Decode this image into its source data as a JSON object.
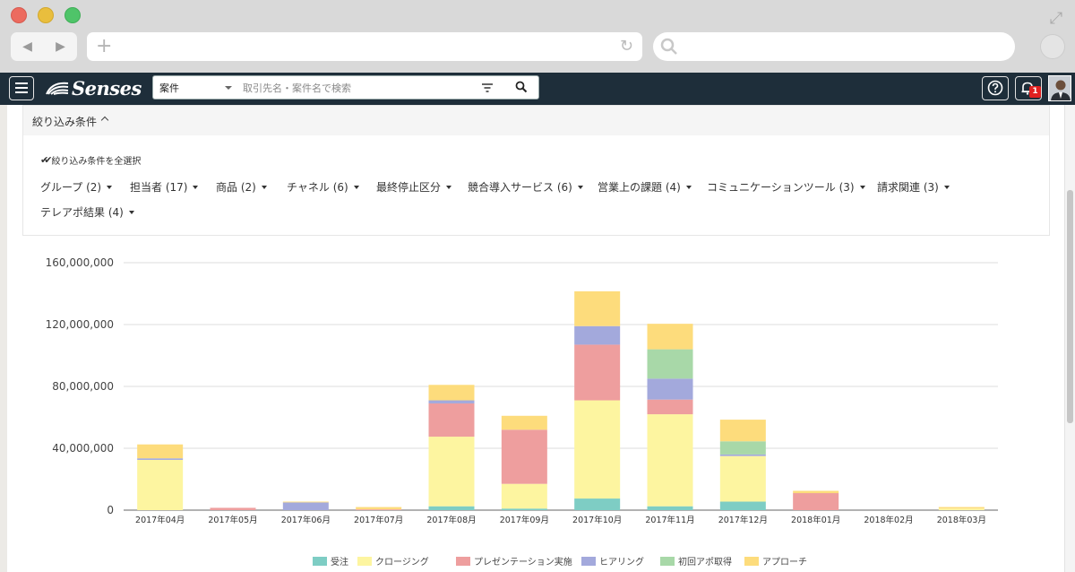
{
  "browser": {
    "window_buttons": [
      "close",
      "minimize",
      "maximize"
    ],
    "nav_icons": [
      "back-arrow-icon",
      "forward-arrow-icon"
    ]
  },
  "app": {
    "logo": "Senses",
    "search": {
      "type_value": "案件",
      "placeholder": "取引先名・案件名で検索"
    },
    "notification_count": "1"
  },
  "filter": {
    "title": "絞り込み条件",
    "select_all": "絞り込み条件を全選択",
    "items": [
      "グループ (2)",
      "担当者 (17)",
      "商品 (2)",
      "チャネル (6)",
      "最終停止区分",
      "競合導入サービス (6)",
      "営業上の課題 (4)",
      "コミュニケーションツール (3)",
      "請求関連 (3)",
      "テレアポ結果 (4)"
    ]
  },
  "chart_data": {
    "type": "bar",
    "stacked": true,
    "categories": [
      "2017年04月",
      "2017年05月",
      "2017年06月",
      "2017年07月",
      "2017年08月",
      "2017年09月",
      "2017年10月",
      "2017年11月",
      "2017年12月",
      "2018年01月",
      "2018年02月",
      "2018年03月"
    ],
    "series": [
      {
        "name": "受注",
        "color": "#7ecdc4",
        "values": [
          0,
          0,
          0,
          0,
          2500000,
          1000000,
          7500000,
          2500000,
          5500000,
          0,
          0,
          0
        ]
      },
      {
        "name": "クロージング",
        "color": "#fdf5a0",
        "values": [
          32500000,
          0,
          0,
          0,
          45000000,
          16000000,
          63500000,
          59500000,
          29500000,
          0,
          0,
          1000000
        ]
      },
      {
        "name": "プレゼンテーション実施",
        "color": "#ee9e9e",
        "values": [
          0,
          1500000,
          0,
          500000,
          21500000,
          35000000,
          36000000,
          9500000,
          0,
          11000000,
          0,
          0
        ]
      },
      {
        "name": "ヒアリング",
        "color": "#a3a9dc",
        "values": [
          1000000,
          0,
          5000000,
          0,
          2000000,
          0,
          12000000,
          13500000,
          1000000,
          0,
          0,
          0
        ]
      },
      {
        "name": "初回アポ取得",
        "color": "#a8d8a8",
        "values": [
          0,
          0,
          0,
          0,
          0,
          0,
          0,
          19000000,
          8500000,
          0,
          0,
          0
        ]
      },
      {
        "name": "アプローチ",
        "color": "#fddc7c",
        "values": [
          9000000,
          0,
          500000,
          1500000,
          10000000,
          9000000,
          22500000,
          16500000,
          14000000,
          1500000,
          0,
          1000000
        ]
      }
    ],
    "yticks": [
      "0",
      "40,000,000",
      "80,000,000",
      "120,000,000",
      "160,000,000"
    ],
    "ylim": [
      0,
      160000000
    ],
    "grid": true,
    "legend": "bottom-center"
  }
}
